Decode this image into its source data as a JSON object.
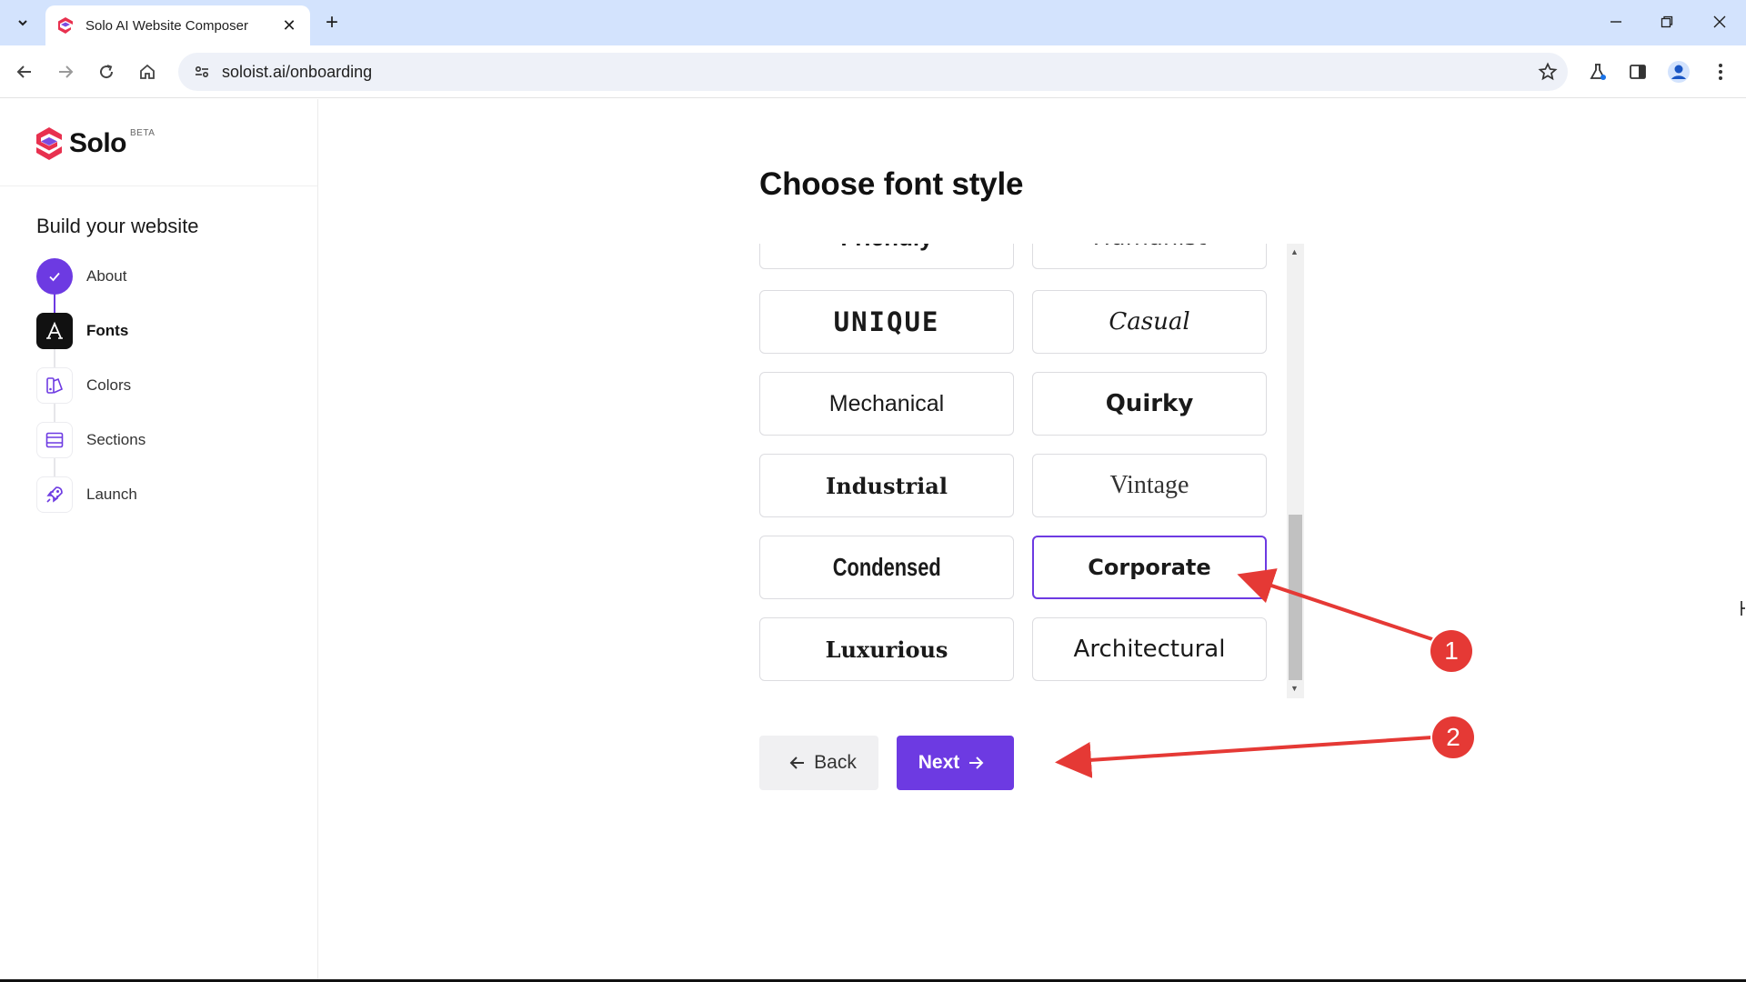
{
  "browser": {
    "tab_title": "Solo AI Website Composer",
    "url": "soloist.ai/onboarding"
  },
  "sidebar": {
    "logo_text": "Solo",
    "logo_badge": "BETA",
    "heading": "Build your website",
    "steps": [
      {
        "label": "About",
        "state": "done",
        "icon": "check-icon"
      },
      {
        "label": "Fonts",
        "state": "active",
        "icon": "font-icon"
      },
      {
        "label": "Colors",
        "state": "pending",
        "icon": "palette-icon"
      },
      {
        "label": "Sections",
        "state": "pending",
        "icon": "sections-icon"
      },
      {
        "label": "Launch",
        "state": "pending",
        "icon": "rocket-icon"
      }
    ]
  },
  "main": {
    "title": "Choose font style",
    "fonts": [
      {
        "label": "Friendly"
      },
      {
        "label": "Humanist"
      },
      {
        "label": "UNIQUE"
      },
      {
        "label": "Casual"
      },
      {
        "label": "Mechanical"
      },
      {
        "label": "Quirky"
      },
      {
        "label": "Industrial"
      },
      {
        "label": "Vintage"
      },
      {
        "label": "Condensed"
      },
      {
        "label": "Corporate",
        "selected": true
      },
      {
        "label": "Luxurious"
      },
      {
        "label": "Architectural"
      }
    ],
    "back_label": "Back",
    "next_label": "Next"
  },
  "annotations": {
    "badge_1": "1",
    "badge_2": "2"
  },
  "colors": {
    "accent": "#6d3ae2",
    "annotation": "#e53935"
  }
}
